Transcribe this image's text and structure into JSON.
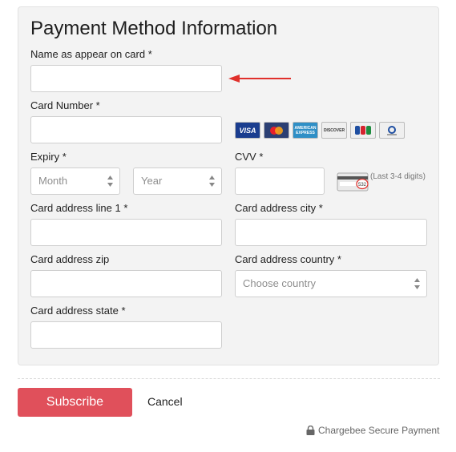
{
  "form": {
    "title": "Payment Method Information",
    "name_label": "Name as appear on card *",
    "card_number_label": "Card Number *",
    "expiry_label": "Expiry *",
    "cvv_label": "CVV *",
    "month_placeholder": "Month",
    "year_placeholder": "Year",
    "cvv_hint": "(Last 3-4 digits)",
    "cvv_sample": "532",
    "address1_label": "Card address line 1 *",
    "city_label": "Card address city *",
    "zip_label": "Card address zip",
    "country_label": "Card address country *",
    "country_placeholder": "Choose country",
    "state_label": "Card address state *"
  },
  "card_brands": [
    {
      "name": "VISA",
      "color": "#1a3d8f"
    },
    {
      "name": "MasterCard",
      "color": "#2b3f73"
    },
    {
      "name": "AMERICAN EXPRESS",
      "color": "#2f8fc6"
    },
    {
      "name": "DISCOVER",
      "color": "#efefef"
    },
    {
      "name": "JCB",
      "color": "#efefef"
    },
    {
      "name": "Diners Club",
      "color": "#efefef"
    }
  ],
  "actions": {
    "subscribe_label": "Subscribe",
    "cancel_label": "Cancel",
    "secure_label": "Chargebee Secure Payment"
  },
  "colors": {
    "accent": "#e0505b",
    "arrow": "#e0302b"
  }
}
